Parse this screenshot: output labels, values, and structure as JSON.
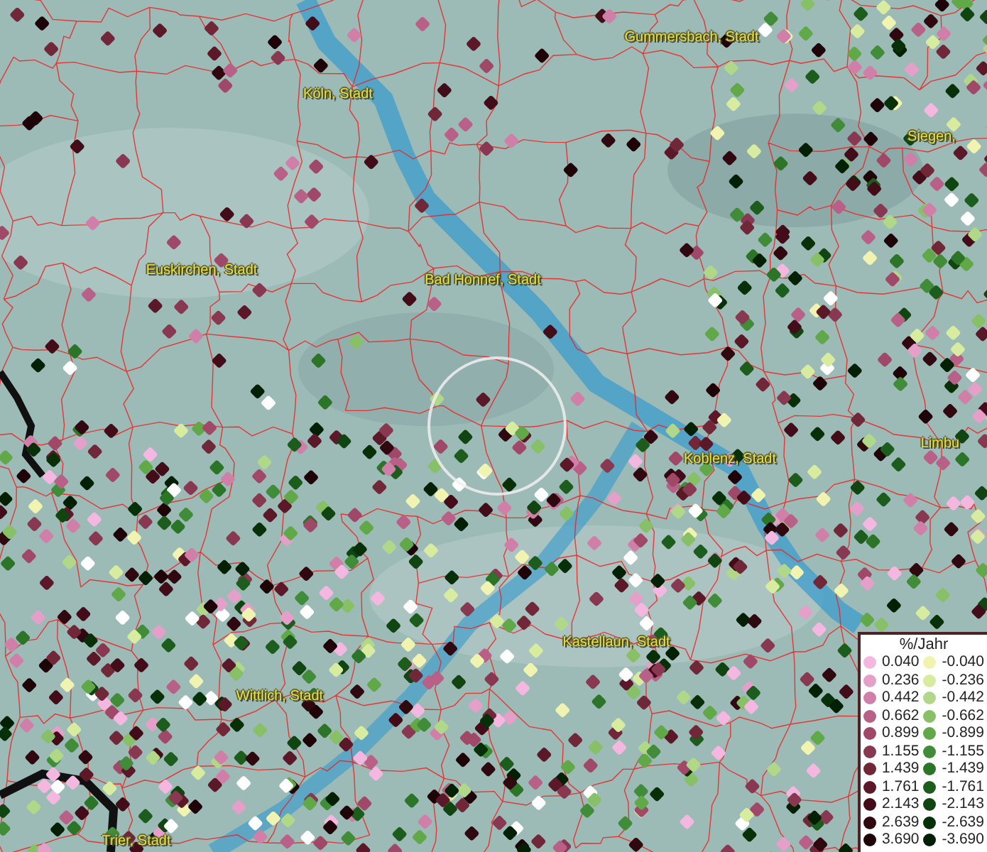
{
  "map_labels": [
    "Gummersbach, Stadt",
    "Köln, Stadt",
    "Siegen,",
    "Euskirchen, Stadt",
    "Bad Honnef, Stadt",
    "Koblenz, Stadt",
    "Limbu",
    "Kastellaun, Stadt",
    "Wittlich, Stadt",
    "Trier, Stadt"
  ],
  "legend": {
    "title": "%/Jahr",
    "positive": [
      {
        "label": "0.040",
        "color": "#f4b8e0"
      },
      {
        "label": "0.236",
        "color": "#e4a0c8"
      },
      {
        "label": "0.442",
        "color": "#d080a8"
      },
      {
        "label": "0.662",
        "color": "#b86088"
      },
      {
        "label": "0.899",
        "color": "#a04868"
      },
      {
        "label": "1.155",
        "color": "#883850"
      },
      {
        "label": "1.439",
        "color": "#702838"
      },
      {
        "label": "1.761",
        "color": "#5a1828"
      },
      {
        "label": "2.143",
        "color": "#420c18"
      },
      {
        "label": "2.639",
        "color": "#300810"
      },
      {
        "label": "3.690",
        "color": "#1e0408"
      }
    ],
    "negative": [
      {
        "label": "-0.040",
        "color": "#f0f4b0"
      },
      {
        "label": "-0.236",
        "color": "#d8eca0"
      },
      {
        "label": "-0.442",
        "color": "#b0d888"
      },
      {
        "label": "-0.662",
        "color": "#88c068"
      },
      {
        "label": "-0.899",
        "color": "#60a848"
      },
      {
        "label": "-1.155",
        "color": "#408c38"
      },
      {
        "label": "-1.439",
        "color": "#2c7428"
      },
      {
        "label": "-1.761",
        "color": "#1c5c1c"
      },
      {
        "label": "-2.143",
        "color": "#104410"
      },
      {
        "label": "-2.639",
        "color": "#083008"
      },
      {
        "label": "-3.690",
        "color": "#042004"
      }
    ]
  }
}
